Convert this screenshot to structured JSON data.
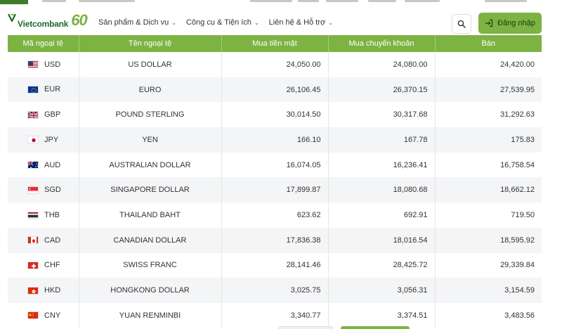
{
  "brand": {
    "name": "Vietcombank",
    "anniversary": "60"
  },
  "nav": [
    {
      "label": "Sản phẩm & Dịch vụ"
    },
    {
      "label": "Công cụ & Tiện ích"
    },
    {
      "label": "Liên hệ & Hỗ trợ"
    }
  ],
  "header": {
    "login_label": "Đăng nhập"
  },
  "table": {
    "columns": [
      "Mã ngoại tệ",
      "Tên ngoại tệ",
      "Mua tiền mặt",
      "Mua chuyển khoản",
      "Bán"
    ],
    "rows": [
      {
        "code": "USD",
        "flag": "us-flag-icon",
        "name": "US DOLLAR",
        "cash": "24,050.00",
        "transfer": "24,080.00",
        "sell": "24,420.00"
      },
      {
        "code": "EUR",
        "flag": "eu-flag-icon",
        "name": "EURO",
        "cash": "26,106.45",
        "transfer": "26,370.15",
        "sell": "27,539.95"
      },
      {
        "code": "GBP",
        "flag": "gb-flag-icon",
        "name": "POUND STERLING",
        "cash": "30,014.50",
        "transfer": "30,317.68",
        "sell": "31,292.63"
      },
      {
        "code": "JPY",
        "flag": "jp-flag-icon",
        "name": "YEN",
        "cash": "166.10",
        "transfer": "167.78",
        "sell": "175.83"
      },
      {
        "code": "AUD",
        "flag": "au-flag-icon",
        "name": "AUSTRALIAN DOLLAR",
        "cash": "16,074.05",
        "transfer": "16,236.41",
        "sell": "16,758.54"
      },
      {
        "code": "SGD",
        "flag": "sg-flag-icon",
        "name": "SINGAPORE DOLLAR",
        "cash": "17,899.87",
        "transfer": "18,080.68",
        "sell": "18,662.12"
      },
      {
        "code": "THB",
        "flag": "th-flag-icon",
        "name": "THAILAND BAHT",
        "cash": "623.62",
        "transfer": "692.91",
        "sell": "719.50"
      },
      {
        "code": "CAD",
        "flag": "ca-flag-icon",
        "name": "CANADIAN DOLLAR",
        "cash": "17,836.38",
        "transfer": "18,016.54",
        "sell": "18,595.92"
      },
      {
        "code": "CHF",
        "flag": "ch-flag-icon",
        "name": "SWISS FRANC",
        "cash": "28,141.46",
        "transfer": "28,425.72",
        "sell": "29,339.84"
      },
      {
        "code": "HKD",
        "flag": "hk-flag-icon",
        "name": "HONGKONG DOLLAR",
        "cash": "3,025.75",
        "transfer": "3,056.31",
        "sell": "3,154.59"
      },
      {
        "code": "CNY",
        "flag": "cn-flag-icon",
        "name": "YUAN RENMINBI",
        "cash": "3,340.77",
        "transfer": "3,374.51",
        "sell": "3,483.56"
      }
    ]
  },
  "colors": {
    "brand_green": "#7cb342",
    "brand_dark": "#1d6b2c"
  }
}
